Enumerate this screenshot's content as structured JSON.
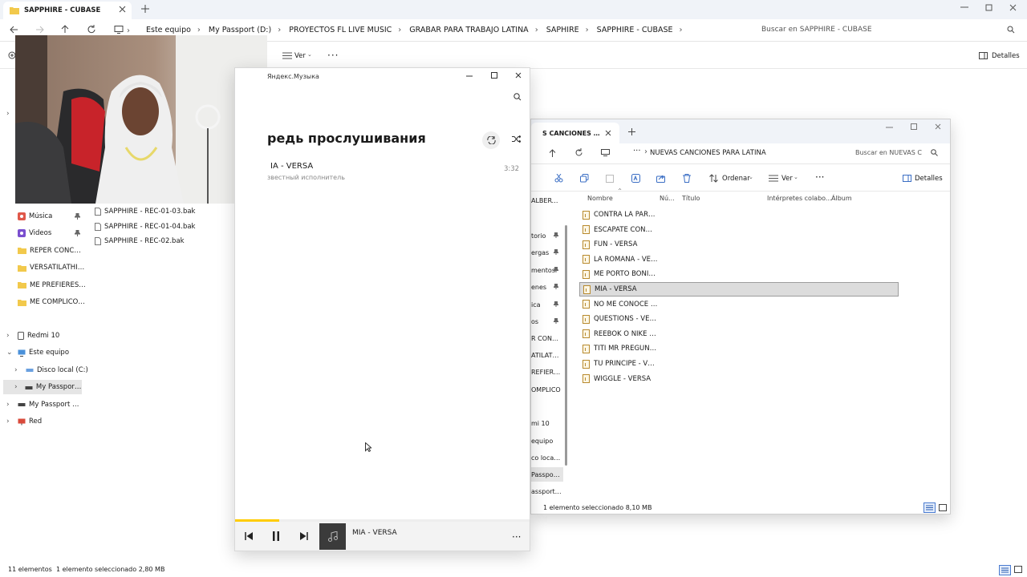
{
  "main": {
    "tab_title": "SAPPHIRE  - CUBASE",
    "breadcrumb": [
      "Este equipo",
      "My Passport (D:)",
      "PROYECTOS FL LIVE MUSIC",
      "GRABAR PARA TRABAJO LATINA",
      "SAPHIRE",
      "SAPPHIRE  - CUBASE"
    ],
    "search_placeholder": "Buscar en SAPPHIRE  - CUBASE",
    "toolbar_view": "Ver",
    "details": "Detalles",
    "nav": {
      "quick": [
        {
          "label": "Música",
          "icon": "music-icon",
          "color": "#e0584a"
        },
        {
          "label": "Videos",
          "icon": "video-icon",
          "color": "#7a4fcf"
        },
        {
          "label": "REPER CONCURSO",
          "icon": "folder-icon",
          "color": "#f2c94c"
        },
        {
          "label": "VERSATILATHION (",
          "icon": "folder-icon",
          "color": "#f2c94c"
        },
        {
          "label": "ME PREFIERES A M",
          "icon": "folder-icon",
          "color": "#f2c94c"
        },
        {
          "label": "ME COMPLICO STI",
          "icon": "folder-icon",
          "color": "#f2c94c"
        }
      ],
      "tree": [
        {
          "label": "Redmi 10",
          "level": 0
        },
        {
          "label": "Este equipo",
          "level": 0
        },
        {
          "label": "Disco local (C:)",
          "level": 1
        },
        {
          "label": "My Passport (D:)",
          "level": 1
        },
        {
          "label": "My Passport (D:)",
          "level": 0
        },
        {
          "label": "Red",
          "level": 0
        }
      ]
    },
    "files": [
      "SAPPHIRE - REC-01-03.bak",
      "SAPPHIRE - REC-01-04.bak",
      "SAPPHIRE - REC-02.bak"
    ],
    "status_count": "11 elementos",
    "status_selected": "1 elemento seleccionado  2,80 MB"
  },
  "music": {
    "app_title": "Яндекс.Музыка",
    "heading": "редь прослушивания",
    "track_title": "IA - VERSA",
    "track_artist": "звестный исполнитель",
    "track_duration": "3:32",
    "progress": 0.15,
    "player_track": "MIA - VERSA"
  },
  "exp2": {
    "tab_title": "S CANCIONES PARA LA",
    "breadcrumb": "NUEVAS CANCIONES PARA LATINA",
    "search_placeholder": "Buscar en NUEVAS C",
    "sort_label": "Ordenar",
    "view_label": "Ver",
    "details": "Detalles",
    "columns": [
      "Nombre",
      "Nú...",
      "Título",
      "Intérpretes colabo...",
      "Álbum"
    ],
    "songs": [
      "CONTRA LA PARED...",
      "ESCAPATE CONMIG...",
      "FUN - VERSA",
      "LA ROMANA  - VER...",
      "ME PORTO BONITO...",
      "MIA - VERSA",
      "NO ME CONOCE  - ...",
      "QUESTIONS  - VERSA",
      "REEBOK O NIKE  - V...",
      "TITI MR PREGUNTO...",
      "TU PRINCIPE  - VER...",
      "WIGGLE - VERSA"
    ],
    "selected_index": 5,
    "side": [
      "ALBERTO -",
      "torio",
      "ergas",
      "mentos",
      "enes",
      "ica",
      "os",
      "R CONCUR",
      "ATILATHIO",
      "REFIERES A",
      "OMPLICO",
      "mi 10",
      "equipo",
      "co local (C:",
      "Passport (",
      "assport (D:"
    ],
    "status": "1 elemento seleccionado  8,10 MB"
  }
}
